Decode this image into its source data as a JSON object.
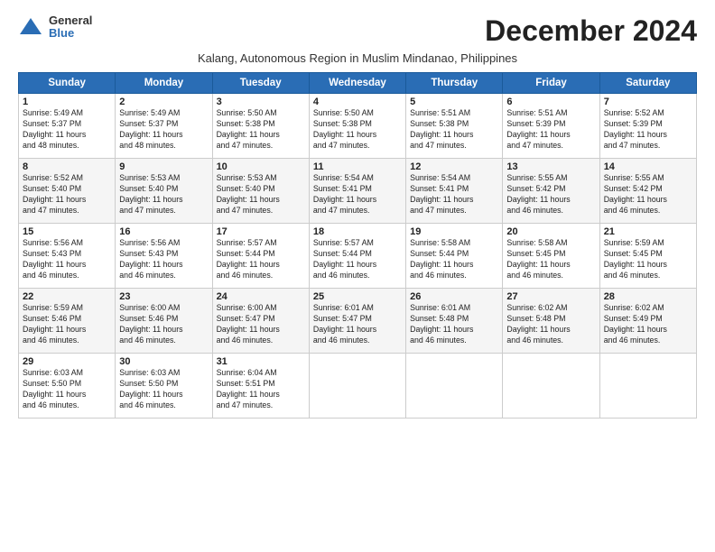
{
  "header": {
    "logo_general": "General",
    "logo_blue": "Blue",
    "title": "December 2024",
    "subtitle": "Kalang, Autonomous Region in Muslim Mindanao, Philippines"
  },
  "days_of_week": [
    "Sunday",
    "Monday",
    "Tuesday",
    "Wednesday",
    "Thursday",
    "Friday",
    "Saturday"
  ],
  "weeks": [
    [
      {
        "day": "1",
        "info": "Sunrise: 5:49 AM\nSunset: 5:37 PM\nDaylight: 11 hours\nand 48 minutes."
      },
      {
        "day": "2",
        "info": "Sunrise: 5:49 AM\nSunset: 5:37 PM\nDaylight: 11 hours\nand 48 minutes."
      },
      {
        "day": "3",
        "info": "Sunrise: 5:50 AM\nSunset: 5:38 PM\nDaylight: 11 hours\nand 47 minutes."
      },
      {
        "day": "4",
        "info": "Sunrise: 5:50 AM\nSunset: 5:38 PM\nDaylight: 11 hours\nand 47 minutes."
      },
      {
        "day": "5",
        "info": "Sunrise: 5:51 AM\nSunset: 5:38 PM\nDaylight: 11 hours\nand 47 minutes."
      },
      {
        "day": "6",
        "info": "Sunrise: 5:51 AM\nSunset: 5:39 PM\nDaylight: 11 hours\nand 47 minutes."
      },
      {
        "day": "7",
        "info": "Sunrise: 5:52 AM\nSunset: 5:39 PM\nDaylight: 11 hours\nand 47 minutes."
      }
    ],
    [
      {
        "day": "8",
        "info": "Sunrise: 5:52 AM\nSunset: 5:40 PM\nDaylight: 11 hours\nand 47 minutes."
      },
      {
        "day": "9",
        "info": "Sunrise: 5:53 AM\nSunset: 5:40 PM\nDaylight: 11 hours\nand 47 minutes."
      },
      {
        "day": "10",
        "info": "Sunrise: 5:53 AM\nSunset: 5:40 PM\nDaylight: 11 hours\nand 47 minutes."
      },
      {
        "day": "11",
        "info": "Sunrise: 5:54 AM\nSunset: 5:41 PM\nDaylight: 11 hours\nand 47 minutes."
      },
      {
        "day": "12",
        "info": "Sunrise: 5:54 AM\nSunset: 5:41 PM\nDaylight: 11 hours\nand 47 minutes."
      },
      {
        "day": "13",
        "info": "Sunrise: 5:55 AM\nSunset: 5:42 PM\nDaylight: 11 hours\nand 46 minutes."
      },
      {
        "day": "14",
        "info": "Sunrise: 5:55 AM\nSunset: 5:42 PM\nDaylight: 11 hours\nand 46 minutes."
      }
    ],
    [
      {
        "day": "15",
        "info": "Sunrise: 5:56 AM\nSunset: 5:43 PM\nDaylight: 11 hours\nand 46 minutes."
      },
      {
        "day": "16",
        "info": "Sunrise: 5:56 AM\nSunset: 5:43 PM\nDaylight: 11 hours\nand 46 minutes."
      },
      {
        "day": "17",
        "info": "Sunrise: 5:57 AM\nSunset: 5:44 PM\nDaylight: 11 hours\nand 46 minutes."
      },
      {
        "day": "18",
        "info": "Sunrise: 5:57 AM\nSunset: 5:44 PM\nDaylight: 11 hours\nand 46 minutes."
      },
      {
        "day": "19",
        "info": "Sunrise: 5:58 AM\nSunset: 5:44 PM\nDaylight: 11 hours\nand 46 minutes."
      },
      {
        "day": "20",
        "info": "Sunrise: 5:58 AM\nSunset: 5:45 PM\nDaylight: 11 hours\nand 46 minutes."
      },
      {
        "day": "21",
        "info": "Sunrise: 5:59 AM\nSunset: 5:45 PM\nDaylight: 11 hours\nand 46 minutes."
      }
    ],
    [
      {
        "day": "22",
        "info": "Sunrise: 5:59 AM\nSunset: 5:46 PM\nDaylight: 11 hours\nand 46 minutes."
      },
      {
        "day": "23",
        "info": "Sunrise: 6:00 AM\nSunset: 5:46 PM\nDaylight: 11 hours\nand 46 minutes."
      },
      {
        "day": "24",
        "info": "Sunrise: 6:00 AM\nSunset: 5:47 PM\nDaylight: 11 hours\nand 46 minutes."
      },
      {
        "day": "25",
        "info": "Sunrise: 6:01 AM\nSunset: 5:47 PM\nDaylight: 11 hours\nand 46 minutes."
      },
      {
        "day": "26",
        "info": "Sunrise: 6:01 AM\nSunset: 5:48 PM\nDaylight: 11 hours\nand 46 minutes."
      },
      {
        "day": "27",
        "info": "Sunrise: 6:02 AM\nSunset: 5:48 PM\nDaylight: 11 hours\nand 46 minutes."
      },
      {
        "day": "28",
        "info": "Sunrise: 6:02 AM\nSunset: 5:49 PM\nDaylight: 11 hours\nand 46 minutes."
      }
    ],
    [
      {
        "day": "29",
        "info": "Sunrise: 6:03 AM\nSunset: 5:50 PM\nDaylight: 11 hours\nand 46 minutes."
      },
      {
        "day": "30",
        "info": "Sunrise: 6:03 AM\nSunset: 5:50 PM\nDaylight: 11 hours\nand 46 minutes."
      },
      {
        "day": "31",
        "info": "Sunrise: 6:04 AM\nSunset: 5:51 PM\nDaylight: 11 hours\nand 47 minutes."
      },
      {
        "day": "",
        "info": ""
      },
      {
        "day": "",
        "info": ""
      },
      {
        "day": "",
        "info": ""
      },
      {
        "day": "",
        "info": ""
      }
    ]
  ]
}
